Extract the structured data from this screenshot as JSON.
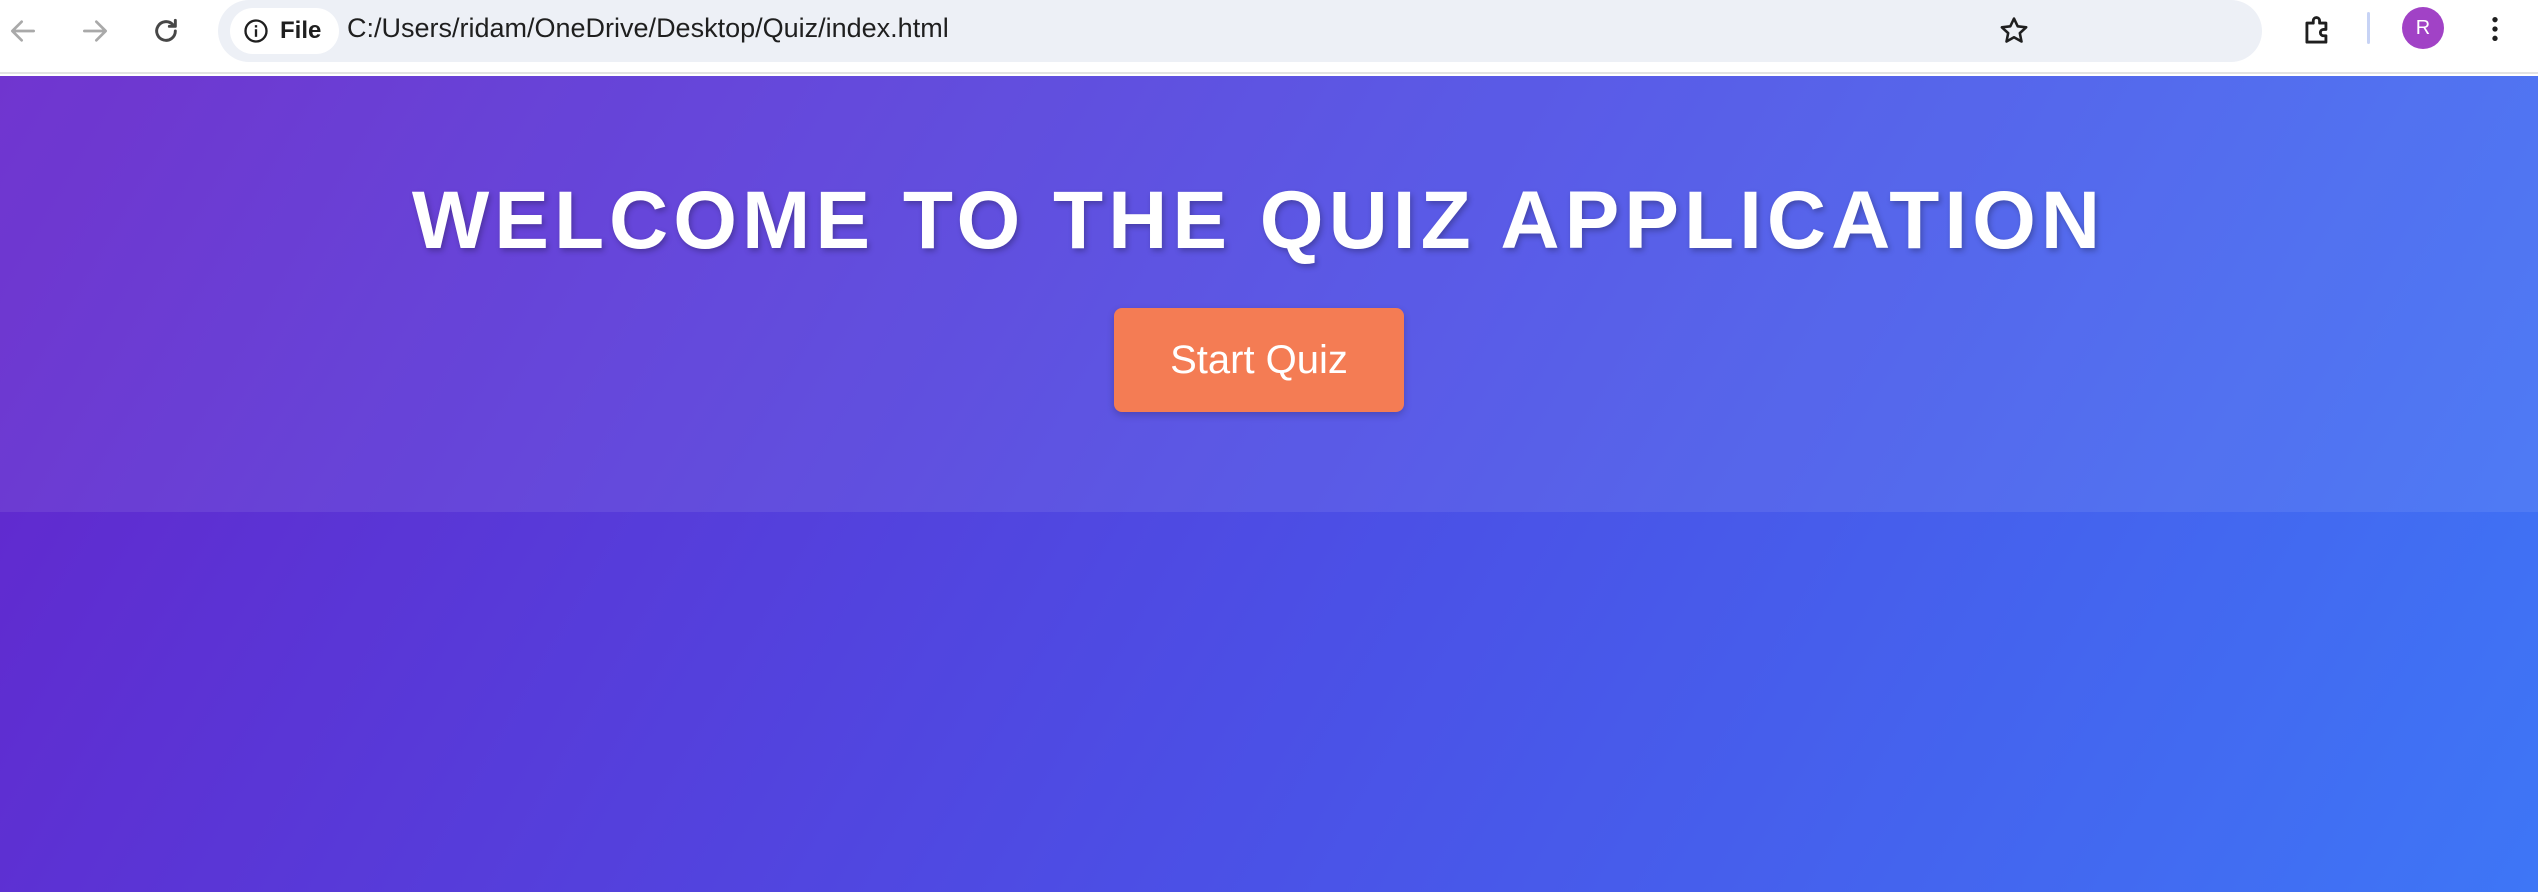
{
  "browser": {
    "back_icon": "arrow-left-icon",
    "forward_icon": "arrow-right-icon",
    "reload_icon": "reload-icon",
    "site_info_icon": "info-circle-icon",
    "site_chip_label": "File",
    "url": "C:/Users/ridam/OneDrive/Desktop/Quiz/index.html",
    "bookmark_icon": "star-icon",
    "extensions_icon": "puzzle-icon",
    "profile_initial": "R",
    "menu_icon": "more-vertical-icon",
    "colors": {
      "omnibox_bg": "#edf0f6",
      "avatar_bg": "#a142c6"
    }
  },
  "page": {
    "title": "WELCOME TO THE QUIZ APPLICATION",
    "start_button_label": "Start Quiz",
    "colors": {
      "gradient_start": "#6424cb",
      "gradient_end": "#3e76f6",
      "button_bg": "#f47c54",
      "title_text": "#ffffff"
    }
  }
}
